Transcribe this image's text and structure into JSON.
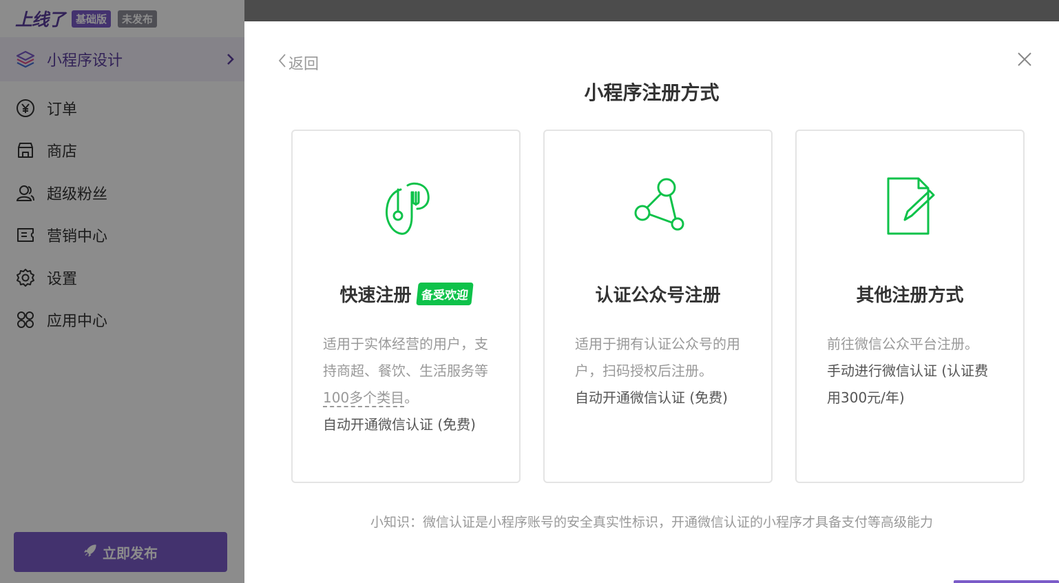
{
  "sidebar": {
    "logo": "上线了",
    "badge_basic": "基础版",
    "badge_unpublished": "未发布",
    "nav_head": "小程序设计",
    "items": [
      {
        "label": "订单",
        "icon": "yen-circle-icon"
      },
      {
        "label": "商店",
        "icon": "store-icon"
      },
      {
        "label": "超级粉丝",
        "icon": "fans-icon"
      },
      {
        "label": "营销中心",
        "icon": "ticket-icon"
      },
      {
        "label": "设置",
        "icon": "gear-icon"
      },
      {
        "label": "应用中心",
        "icon": "apps-grid-icon"
      }
    ],
    "publish_label": "立即发布"
  },
  "modal": {
    "back_label": "返回",
    "title": "小程序注册方式",
    "cards": [
      {
        "name": "快速注册",
        "badge": "备受欢迎",
        "icon": "fork-spoon-icon",
        "desc_1": "适用于实体经营的用户，支持商超、餐饮、生活服务等",
        "desc_link": "100多个类目",
        "desc_end": "。",
        "desc_dark": "自动开通微信认证 (免费)"
      },
      {
        "name": "认证公众号注册",
        "icon": "share-nodes-icon",
        "desc_1": "适用于拥有认证公众号的用户，扫码授权后注册。",
        "desc_dark": "自动开通微信认证 (免费)"
      },
      {
        "name": "其他注册方式",
        "icon": "document-edit-icon",
        "desc_1": "前往微信公众平台注册。",
        "desc_dark": "手动进行微信认证 (认证费用300元/年)"
      }
    ],
    "tip": "小知识：微信认证是小程序账号的安全真实性标识，开通微信认证的小程序才具备支付等高级能力"
  },
  "colors": {
    "brand_purple": "#7b5cc8",
    "accent_green": "#0ec24a"
  }
}
